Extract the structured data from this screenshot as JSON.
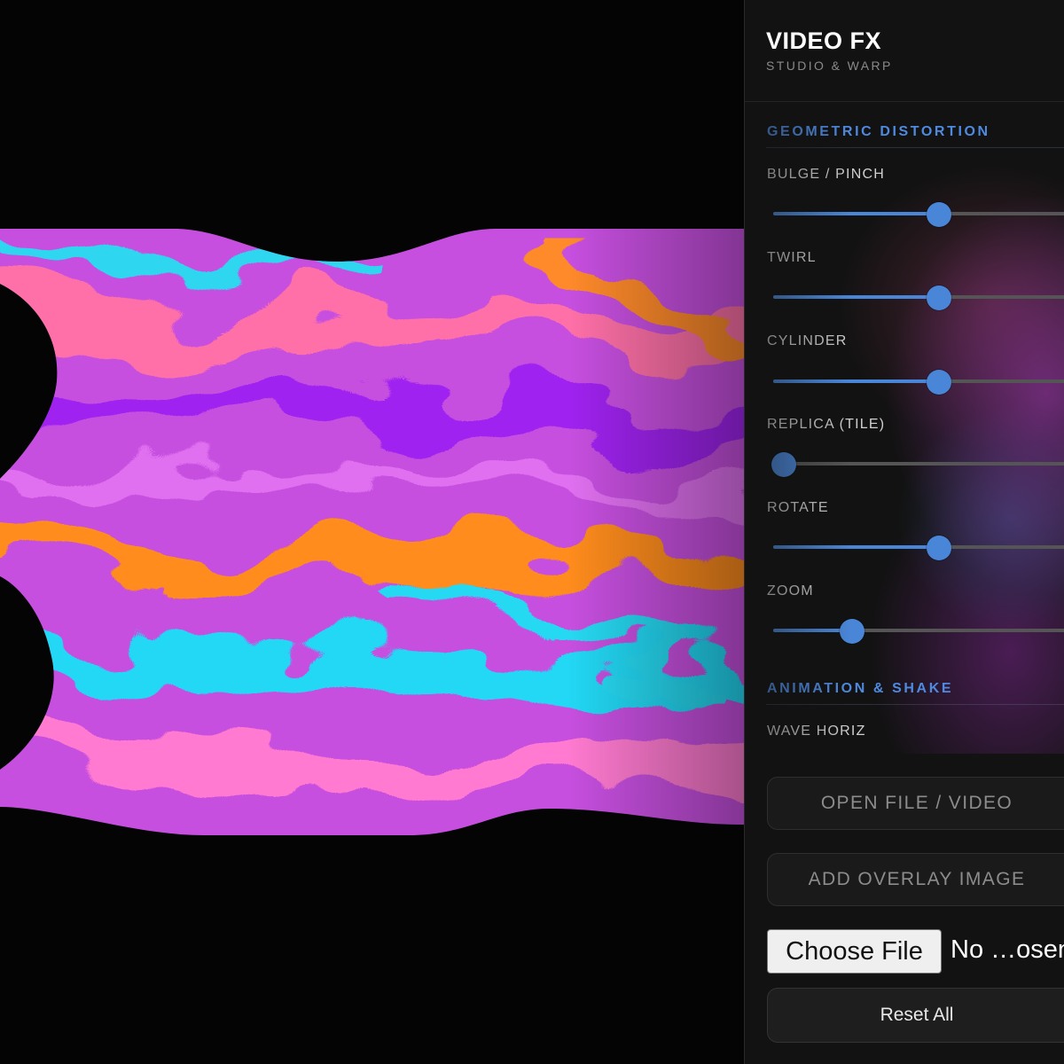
{
  "app": {
    "title": "VIDEO FX",
    "subtitle": "STUDIO & WARP"
  },
  "sections": [
    {
      "heading": "GEOMETRIC DISTORTION",
      "controls": [
        {
          "label": "BULGE / PINCH",
          "value": 0.5
        },
        {
          "label": "TWIRL",
          "value": 0.5
        },
        {
          "label": "CYLINDER",
          "value": 0.5
        },
        {
          "label": "REPLICA (TILE)",
          "value": 0.0
        },
        {
          "label": "ROTATE",
          "value": 0.5
        },
        {
          "label": "ZOOM",
          "value": 0.22
        }
      ]
    },
    {
      "heading": "ANIMATION & SHAKE",
      "controls": [
        {
          "label": "WAVE HORIZ"
        }
      ]
    }
  ],
  "actions": {
    "open_file_label": "OPEN FILE / VIDEO",
    "add_overlay_label": "ADD OVERLAY IMAGE",
    "choose_file_label": "Choose File",
    "file_status": "No …osen",
    "reset_label": "Reset All"
  },
  "colors": {
    "accent": "#4a86d8",
    "section_heading": "#4f8ae0",
    "panel_bg": "#121212",
    "canvas_bg": "#040404"
  }
}
